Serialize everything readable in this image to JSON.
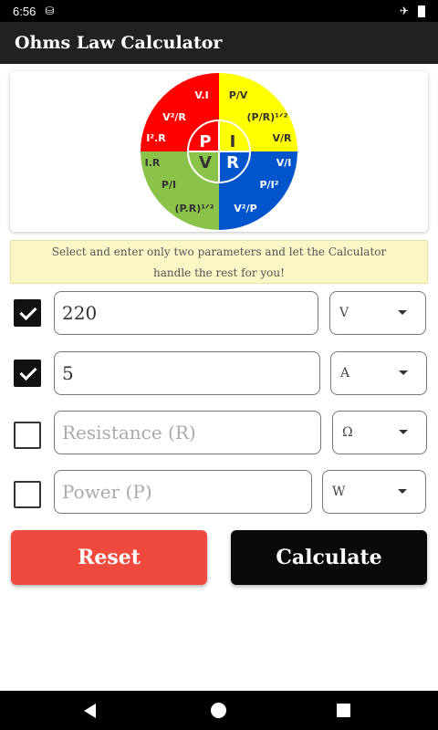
{
  "status_bar": {
    "time": "6:56",
    "icons_left": [
      "sim-icon"
    ],
    "icons_right": [
      "airplane-icon",
      "battery-icon"
    ]
  },
  "app_bar": {
    "title": "Ohms Law Calculator"
  },
  "wheel": {
    "center_letters": {
      "p": "P",
      "i": "I",
      "v": "V",
      "r": "R"
    },
    "quadrants": {
      "p": {
        "color": "#ff0000",
        "formulas": [
          "V.I",
          "V²/R",
          "I².R"
        ]
      },
      "i": {
        "color": "#ffff00",
        "formulas": [
          "P/V",
          "(P/R)¹ᐟ²",
          "V/R"
        ]
      },
      "r": {
        "color": "#0055cc",
        "formulas": [
          "V/I",
          "P/I²",
          "V²/P"
        ]
      },
      "v": {
        "color": "#8bc34a",
        "formulas": [
          "I.R",
          "P/I",
          "(P.R)¹ᐟ²"
        ]
      }
    }
  },
  "hint": {
    "line1": "Select and enter only two parameters and let the Calculator",
    "line2": "handle the rest for you!"
  },
  "rows": [
    {
      "checked": true,
      "value": "220",
      "placeholder": "",
      "unit": "V"
    },
    {
      "checked": true,
      "value": "5",
      "placeholder": "",
      "unit": "A"
    },
    {
      "checked": false,
      "value": "",
      "placeholder": "Resistance (R)",
      "unit": "Ω"
    },
    {
      "checked": false,
      "value": "",
      "placeholder": "Power (P)",
      "unit": "W"
    }
  ],
  "buttons": {
    "reset": "Reset",
    "calculate": "Calculate"
  },
  "colors": {
    "reset": "#f04a3f",
    "calculate": "#0a0a0a",
    "app_bar": "#212121",
    "hint_bg": "#fbf6c6"
  }
}
